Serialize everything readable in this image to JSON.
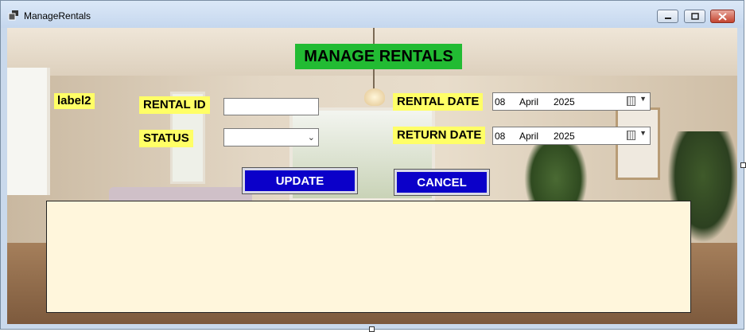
{
  "window": {
    "title": "ManageRentals",
    "icon": "app-window-icon",
    "controls": [
      "minimize-icon",
      "maximize-icon",
      "close-icon"
    ]
  },
  "form": {
    "heading": "MANAGE RENTALS",
    "label2": "label2",
    "rental_id_label": "RENTAL ID",
    "rental_id_value": "",
    "status_label": "STATUS",
    "status_value": "",
    "rental_date_label": "RENTAL DATE",
    "rental_date": {
      "day": "08",
      "month": "April",
      "year": "2025"
    },
    "return_date_label": "RETURN DATE",
    "return_date": {
      "day": "08",
      "month": "April",
      "year": "2025"
    },
    "update_label": "UPDATE",
    "cancel_label": "CANCEL"
  },
  "colors": {
    "heading_bg": "#22bb33",
    "label_bg": "#ffff66",
    "button_bg": "#0b00c9",
    "grid_bg": "#fff6dc"
  },
  "grid": {
    "rows": []
  }
}
